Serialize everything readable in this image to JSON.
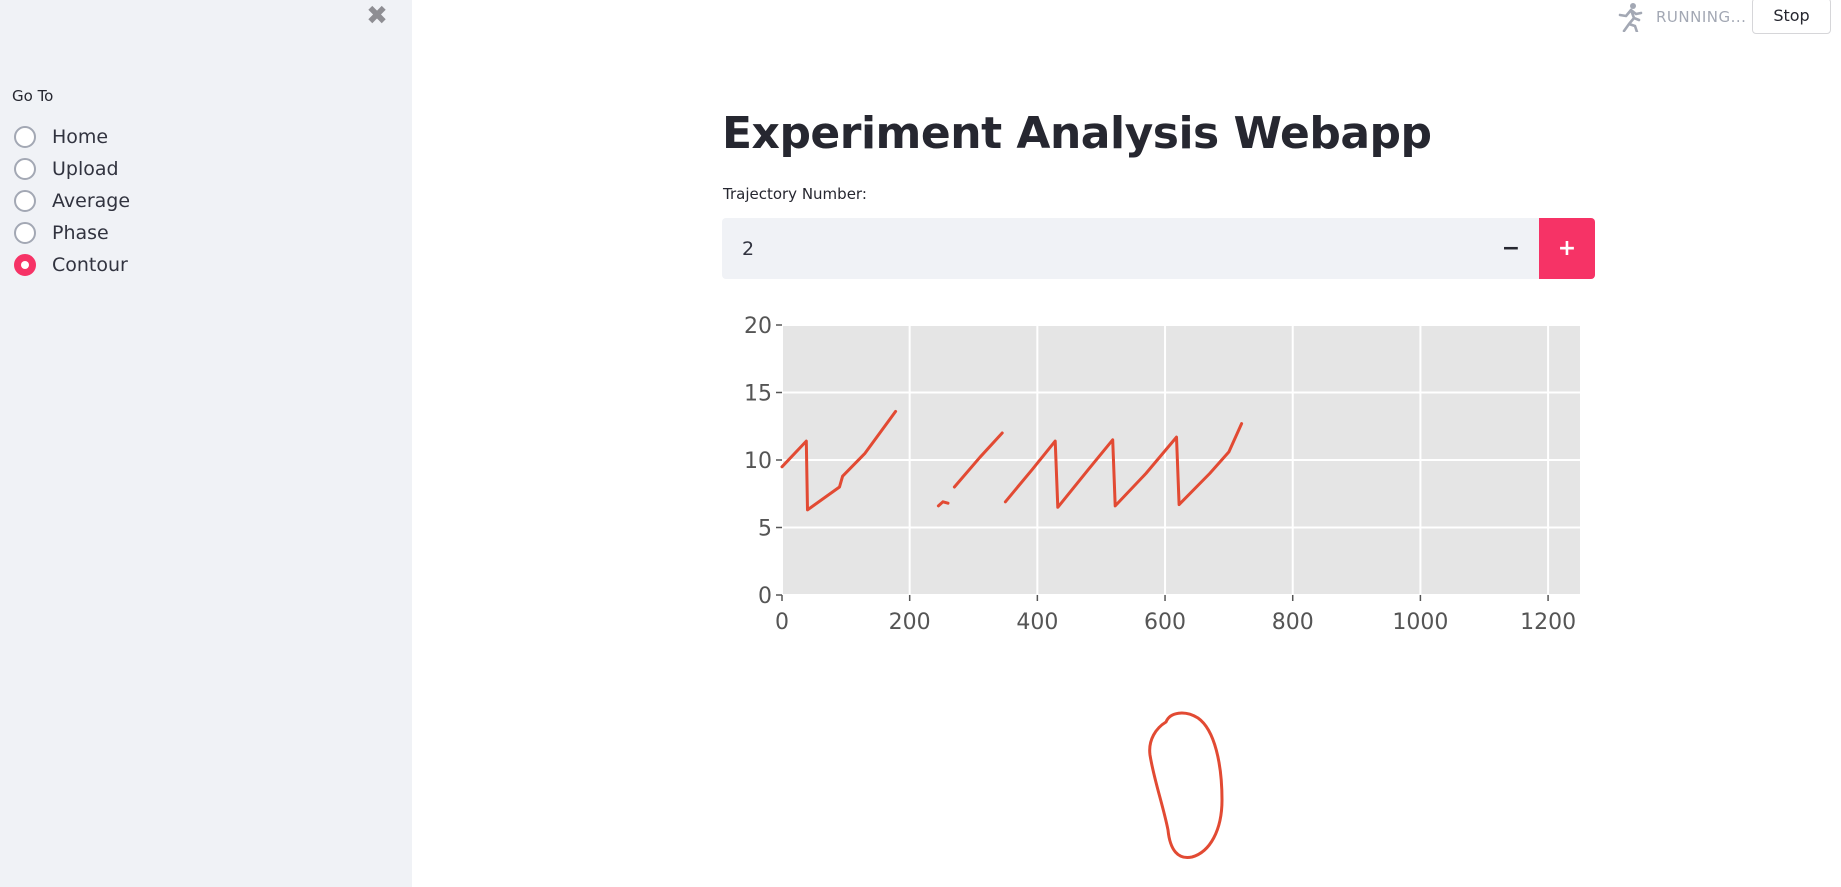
{
  "sidebar": {
    "nav_title": "Go To",
    "items": [
      {
        "label": "Home",
        "selected": false
      },
      {
        "label": "Upload",
        "selected": false
      },
      {
        "label": "Average",
        "selected": false
      },
      {
        "label": "Phase",
        "selected": false
      },
      {
        "label": "Contour",
        "selected": true
      }
    ],
    "close_icon": "close-icon"
  },
  "status": {
    "running_text": "RUNNING...",
    "icon": "running-man-icon",
    "stop_label": "Stop"
  },
  "main": {
    "title": "Experiment Analysis Webapp",
    "trajectory_label": "Trajectory Number:",
    "trajectory_value": "2",
    "minus_label": "−",
    "plus_label": "+"
  },
  "colors": {
    "accent": "#f63366",
    "line": "#e24a33",
    "plot_bg": "#e5e5e5",
    "sidebar_bg": "#f0f2f6"
  },
  "chart_data": {
    "type": "line",
    "xlim": [
      0,
      1250
    ],
    "ylim": [
      0,
      20
    ],
    "xticks": [
      0,
      200,
      400,
      600,
      800,
      1000,
      1200
    ],
    "yticks": [
      0,
      5,
      10,
      15,
      20
    ],
    "grid": true,
    "segments": [
      [
        [
          0,
          9.5
        ],
        [
          38,
          11.4
        ],
        [
          40,
          6.3
        ],
        [
          90,
          8.0
        ],
        [
          95,
          8.8
        ],
        [
          130,
          10.5
        ],
        [
          178,
          13.6
        ]
      ],
      [
        [
          245,
          6.6
        ],
        [
          252,
          6.9
        ],
        [
          260,
          6.8
        ]
      ],
      [
        [
          270,
          8.0
        ],
        [
          310,
          10.2
        ],
        [
          345,
          12.0
        ]
      ],
      [
        [
          350,
          6.9
        ],
        [
          392,
          9.3
        ],
        [
          428,
          11.4
        ],
        [
          432,
          6.5
        ],
        [
          480,
          9.3
        ],
        [
          518,
          11.5
        ],
        [
          522,
          6.6
        ],
        [
          570,
          9.0
        ],
        [
          618,
          11.7
        ],
        [
          622,
          6.7
        ],
        [
          670,
          9.0
        ],
        [
          700,
          10.6
        ],
        [
          720,
          12.7
        ]
      ]
    ]
  }
}
